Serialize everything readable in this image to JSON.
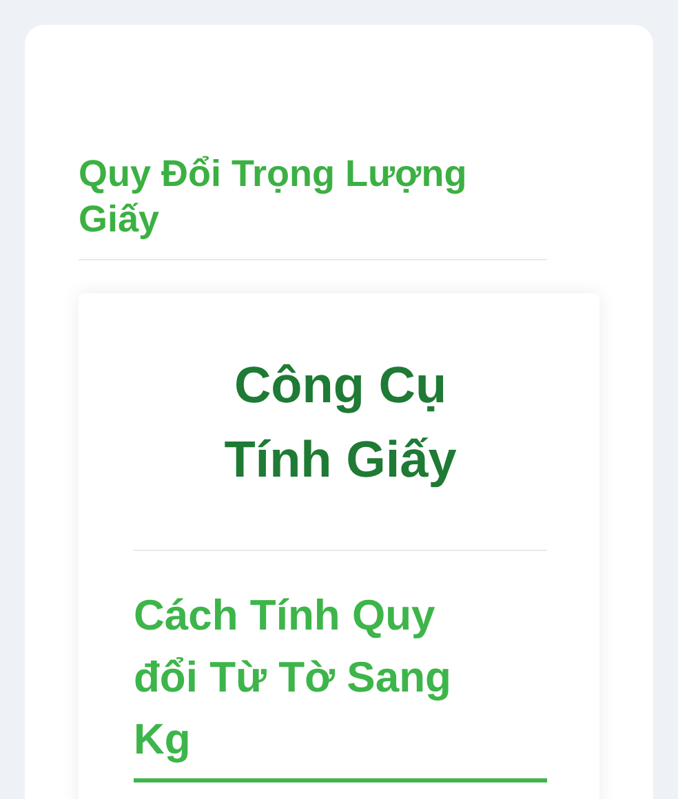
{
  "page_title": "Quy Đổi Trọng Lượng Giấy",
  "card": {
    "title": "Công Cụ Tính Giấy",
    "section_heading": "Cách Tính Quy đổi Từ Tờ Sang Kg"
  }
}
